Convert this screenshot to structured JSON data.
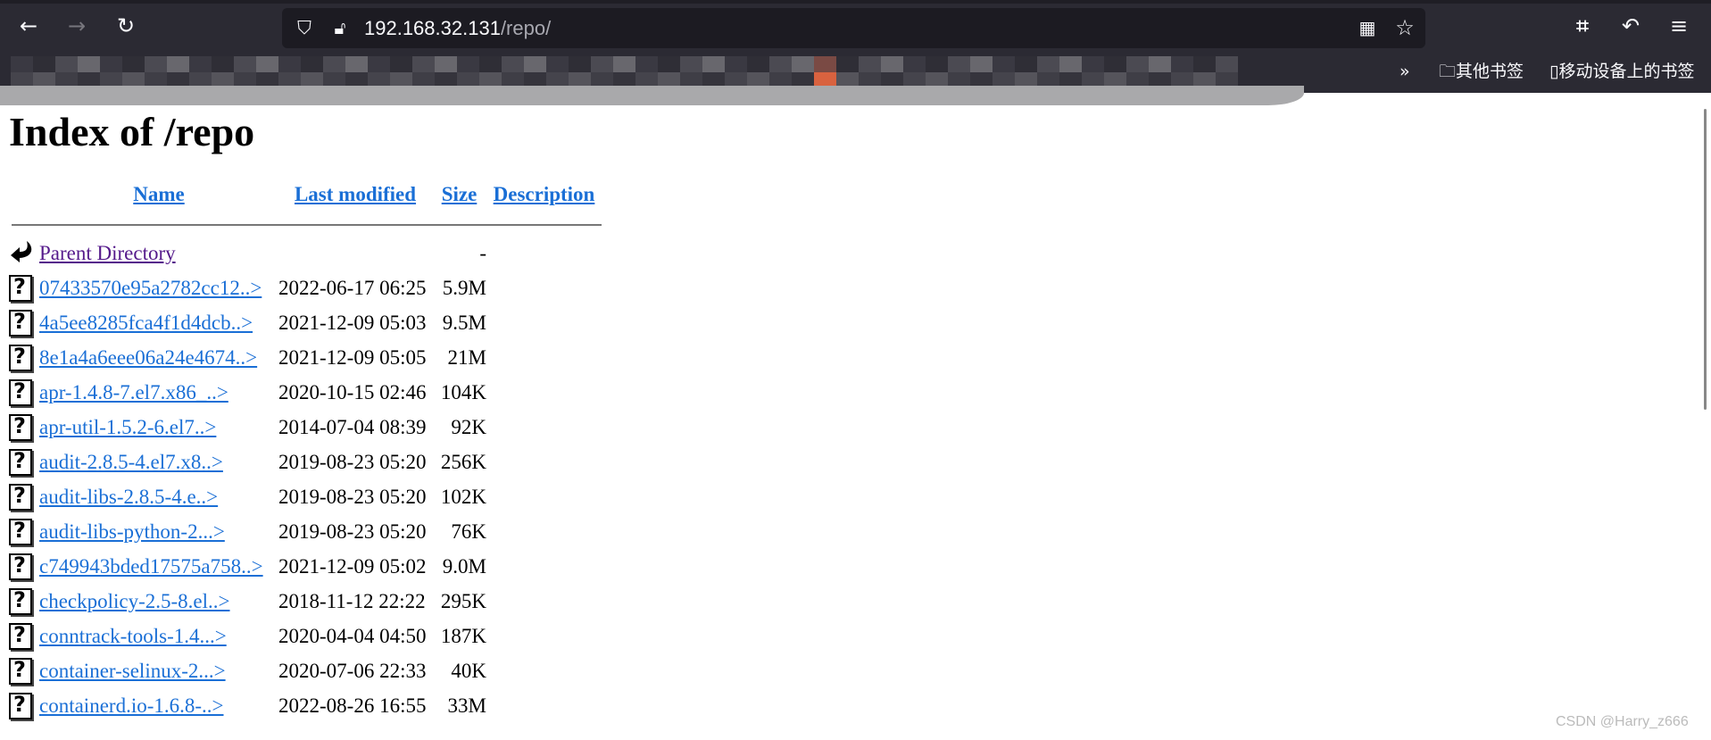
{
  "browser": {
    "url_host": "192.168.32.131",
    "url_path": "/repo/",
    "icons": [
      "back-icon",
      "forward-icon",
      "reload-icon",
      "shield-icon",
      "insecure-lock-icon",
      "qr-code-icon",
      "star-icon",
      "crop-icon",
      "undo-icon",
      "menu-icon"
    ],
    "bookmarks": {
      "overflow": "»",
      "other_bookmarks": "其他书签",
      "mobile_bookmarks": "移动设备上的书签"
    }
  },
  "page": {
    "title": "Index of /repo",
    "headers": {
      "name": "Name",
      "last_modified": "Last modified",
      "size": "Size",
      "description": "Description"
    },
    "parent": {
      "name": "Parent Directory",
      "size": "-"
    },
    "rows": [
      {
        "name": "07433570e95a2782cc12..>",
        "date": "2022-06-17 06:25",
        "size": "5.9M"
      },
      {
        "name": "4a5ee8285fca4f1d4dcb..>",
        "date": "2021-12-09 05:03",
        "size": "9.5M"
      },
      {
        "name": "8e1a4a6eee06a24e4674..>",
        "date": "2021-12-09 05:05",
        "size": "21M"
      },
      {
        "name": "apr-1.4.8-7.el7.x86_..>",
        "date": "2020-10-15 02:46",
        "size": "104K"
      },
      {
        "name": "apr-util-1.5.2-6.el7..>",
        "date": "2014-07-04 08:39",
        "size": "92K"
      },
      {
        "name": "audit-2.8.5-4.el7.x8..>",
        "date": "2019-08-23 05:20",
        "size": "256K"
      },
      {
        "name": "audit-libs-2.8.5-4.e..>",
        "date": "2019-08-23 05:20",
        "size": "102K"
      },
      {
        "name": "audit-libs-python-2...>",
        "date": "2019-08-23 05:20",
        "size": "76K"
      },
      {
        "name": "c749943bded17575a758..>",
        "date": "2021-12-09 05:02",
        "size": "9.0M"
      },
      {
        "name": "checkpolicy-2.5-8.el..>",
        "date": "2018-11-12 22:22",
        "size": "295K"
      },
      {
        "name": "conntrack-tools-1.4...>",
        "date": "2020-04-04 04:50",
        "size": "187K"
      },
      {
        "name": "container-selinux-2...>",
        "date": "2020-07-06 22:33",
        "size": "40K"
      },
      {
        "name": "containerd.io-1.6.8-..>",
        "date": "2022-08-26 16:55",
        "size": "33M"
      }
    ]
  },
  "watermark": "CSDN @Harry_z666",
  "colors": {
    "link": "#1a6fd6",
    "visited": "#551a8b",
    "toolbar": "#2b2a33",
    "urlbar": "#1c1b22"
  }
}
